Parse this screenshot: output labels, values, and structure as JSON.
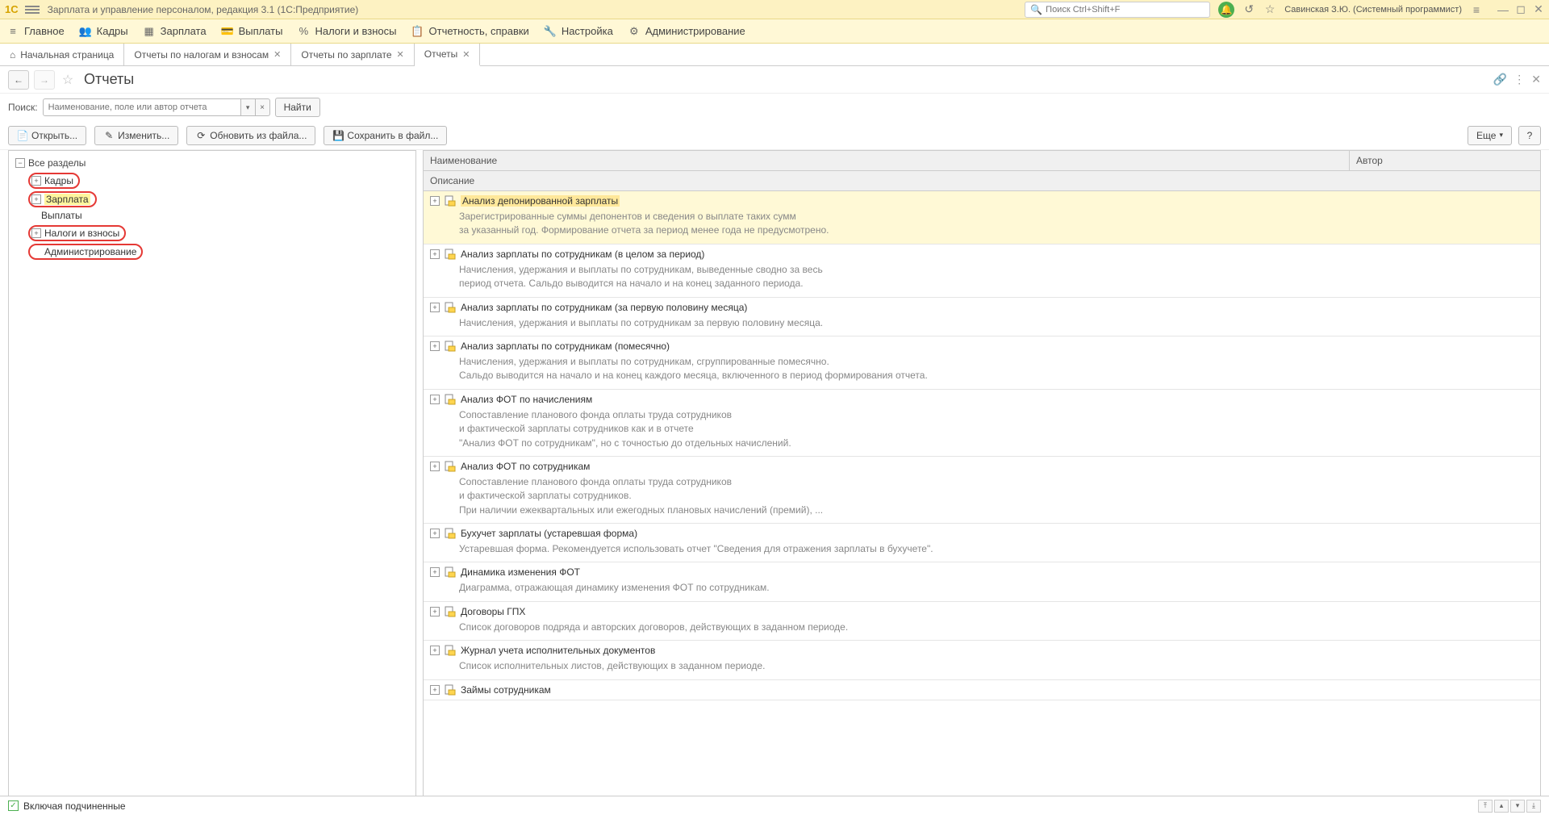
{
  "titlebar": {
    "app_title": "Зарплата и управление персоналом, редакция 3.1  (1С:Предприятие)",
    "search_placeholder": "Поиск Ctrl+Shift+F",
    "user": "Савинская З.Ю. (Системный программист)"
  },
  "mainmenu": [
    {
      "label": "Главное",
      "icon": "menu"
    },
    {
      "label": "Кадры",
      "icon": "people"
    },
    {
      "label": "Зарплата",
      "icon": "table"
    },
    {
      "label": "Выплаты",
      "icon": "wallet"
    },
    {
      "label": "Налоги и взносы",
      "icon": "percent"
    },
    {
      "label": "Отчетность, справки",
      "icon": "doc"
    },
    {
      "label": "Настройка",
      "icon": "wrench"
    },
    {
      "label": "Администрирование",
      "icon": "gear"
    }
  ],
  "tabs": [
    {
      "label": "Начальная страница",
      "closable": false,
      "home": true
    },
    {
      "label": "Отчеты по налогам и взносам",
      "closable": true
    },
    {
      "label": "Отчеты по зарплате",
      "closable": true
    },
    {
      "label": "Отчеты",
      "closable": true,
      "active": true
    }
  ],
  "page": {
    "title": "Отчеты",
    "search_label": "Поиск:",
    "search_placeholder": "Наименование, поле или автор отчета",
    "find_btn": "Найти"
  },
  "toolbar": {
    "open": "Открыть...",
    "edit": "Изменить...",
    "update": "Обновить из файла...",
    "save": "Сохранить в файл...",
    "more": "Еще",
    "help": "?"
  },
  "tree": {
    "root": "Все разделы",
    "items": [
      {
        "label": "Кадры",
        "expandable": true,
        "highlighted": true
      },
      {
        "label": "Зарплата",
        "expandable": true,
        "highlighted": true,
        "selected": true
      },
      {
        "label": "Выплаты",
        "expandable": false,
        "highlighted": false
      },
      {
        "label": "Налоги и взносы",
        "expandable": true,
        "highlighted": true
      },
      {
        "label": "Администрирование",
        "expandable": false,
        "highlighted": true
      }
    ]
  },
  "table": {
    "col_name": "Наименование",
    "col_author": "Автор",
    "col_desc": "Описание"
  },
  "reports": [
    {
      "title": "Анализ депонированной зарплаты",
      "selected": true,
      "desc": "Зарегистрированные суммы депонентов и сведения о выплате таких сумм\nза указанный год. Формирование отчета за период менее года не предусмотрено."
    },
    {
      "title": "Анализ зарплаты по сотрудникам (в целом за период)",
      "desc": "Начисления, удержания и выплаты по сотрудникам, выведенные сводно за весь\nпериод отчета. Сальдо выводится на начало и на конец заданного периода."
    },
    {
      "title": "Анализ зарплаты по сотрудникам (за первую половину месяца)",
      "desc": "Начисления, удержания и выплаты по сотрудникам за первую половину месяца."
    },
    {
      "title": "Анализ зарплаты по сотрудникам (помесячно)",
      "desc": "Начисления, удержания и выплаты по сотрудникам, сгруппированные помесячно.\nСальдо выводится на начало и на конец каждого месяца, включенного в период формирования отчета."
    },
    {
      "title": "Анализ ФОТ по начислениям",
      "desc": "Сопоставление планового фонда оплаты труда сотрудников\nи фактической зарплаты сотрудников как и в отчете\n\"Анализ ФОТ по сотрудникам\", но с точностью до отдельных начислений."
    },
    {
      "title": "Анализ ФОТ по сотрудникам",
      "desc": "Сопоставление планового фонда оплаты труда сотрудников\nи фактической зарплаты сотрудников.\nПри наличии ежеквартальных или ежегодных плановых начислений (премий), ..."
    },
    {
      "title": "Бухучет зарплаты (устаревшая форма)",
      "desc": "Устаревшая форма. Рекомендуется использовать отчет \"Сведения для отражения зарплаты в бухучете\"."
    },
    {
      "title": "Динамика изменения ФОТ",
      "desc": "Диаграмма, отражающая динамику изменения ФОТ по сотрудникам."
    },
    {
      "title": "Договоры ГПХ",
      "desc": "Список договоров подряда и авторских договоров, действующих в заданном периоде."
    },
    {
      "title": "Журнал учета исполнительных документов",
      "desc": "Список исполнительных листов, действующих в заданном периоде."
    },
    {
      "title": "Займы сотрудникам",
      "desc": ""
    }
  ],
  "footer": {
    "checkbox_label": "Включая подчиненные"
  }
}
